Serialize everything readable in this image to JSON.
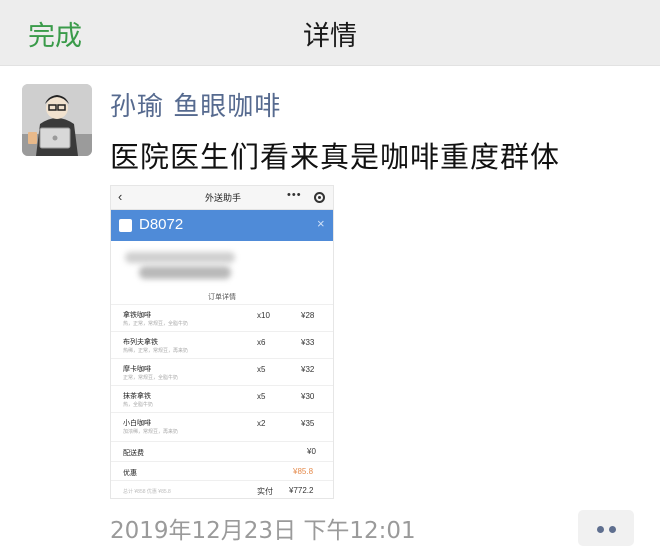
{
  "header": {
    "done_label": "完成",
    "title": "详情"
  },
  "post": {
    "author": "孙瑜 鱼眼咖啡",
    "content": "医院医生们看来真是咖啡重度群体",
    "timestamp": "2019年12月23日 下午12:01",
    "avatar_icon": "avatar-illustration",
    "more_icon": "more-dots-icon"
  },
  "screenshot": {
    "nav": {
      "back_icon": "‹",
      "title": "外送助手",
      "more_icon": "•••"
    },
    "order_banner": {
      "order_id": "D8072",
      "close_icon": "×",
      "color": "#4f8bd8"
    },
    "detail_title": "订单详情",
    "items": [
      {
        "name": "拿铁咖啡",
        "options": "热，正常，常规豆，全脂牛奶",
        "qty": "x10",
        "price": "¥28"
      },
      {
        "name": "布列夫拿铁",
        "options": "热稀，正常，常规豆，再来奶",
        "qty": "x6",
        "price": "¥33"
      },
      {
        "name": "摩卡咖啡",
        "options": "正常，常规豆，全脂牛奶",
        "qty": "x5",
        "price": "¥32"
      },
      {
        "name": "抹茶拿铁",
        "options": "热，全脂牛奶",
        "qty": "x5",
        "price": "¥30"
      },
      {
        "name": "小白咖啡",
        "options": "加浓稀，常规豆，再来奶",
        "qty": "x2",
        "price": "¥35"
      }
    ],
    "delivery": {
      "label": "配送费",
      "value": "¥0"
    },
    "discount": {
      "label": "优惠",
      "value": "¥85.8"
    },
    "footer": {
      "left": "总计 ¥858 优惠 ¥85.8",
      "paid_label": "实付",
      "paid_value": "¥772.2"
    }
  }
}
